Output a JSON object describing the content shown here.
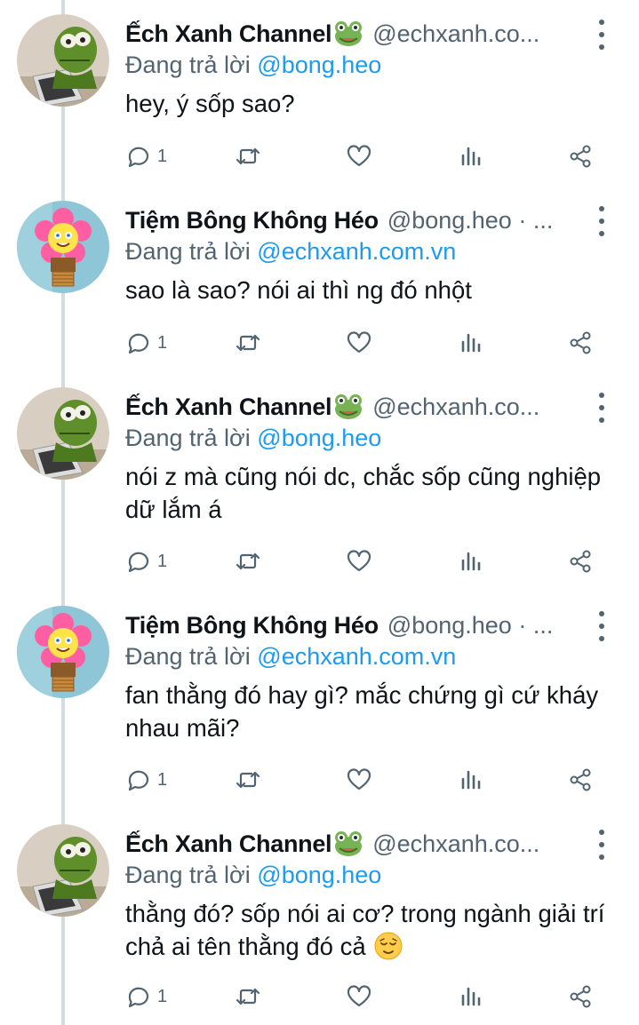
{
  "reply_prefix": "Đang trả lời",
  "tweets": [
    {
      "author": "Ếch Xanh Channel",
      "handle": "@echxanh.co...",
      "has_frog_emoji": true,
      "replying_to": "@bong.heo",
      "text": "hey, ý sốp sao?",
      "reply_count": "1",
      "avatar": "kermit"
    },
    {
      "author": "Tiệm Bông Không Héo",
      "handle": "@bong.heo · ...",
      "has_frog_emoji": false,
      "replying_to": "@echxanh.com.vn",
      "text": "sao là sao? nói ai thì ng đó nhột",
      "reply_count": "1",
      "avatar": "flower"
    },
    {
      "author": "Ếch Xanh Channel",
      "handle": "@echxanh.co...",
      "has_frog_emoji": true,
      "replying_to": "@bong.heo",
      "text": "nói z mà cũng nói dc, chắc sốp cũng nghiệp dữ lắm á",
      "reply_count": "1",
      "avatar": "kermit"
    },
    {
      "author": "Tiệm Bông Không Héo",
      "handle": "@bong.heo · ...",
      "has_frog_emoji": false,
      "replying_to": "@echxanh.com.vn",
      "text": "fan thằng đó hay gì? mắc chứng gì cứ kháy nhau mãi?",
      "reply_count": "1",
      "avatar": "flower"
    },
    {
      "author": "Ếch Xanh Channel",
      "handle": "@echxanh.co...",
      "has_frog_emoji": true,
      "replying_to": "@bong.heo",
      "text": "thằng đó? sốp nói ai cơ? trong ngành giải trí chả ai tên thằng đó cả",
      "reply_count": "1",
      "avatar": "kermit",
      "trailing_emoji": "relieved-face"
    }
  ],
  "icons": [
    "reply-icon",
    "retweet-icon",
    "like-icon",
    "views-icon",
    "share-icon",
    "more-icon",
    "frog-emoji"
  ],
  "colors": {
    "text": "#0f1419",
    "muted": "#536471",
    "link": "#1d9bf0",
    "thread_line": "#d6dbe0"
  }
}
